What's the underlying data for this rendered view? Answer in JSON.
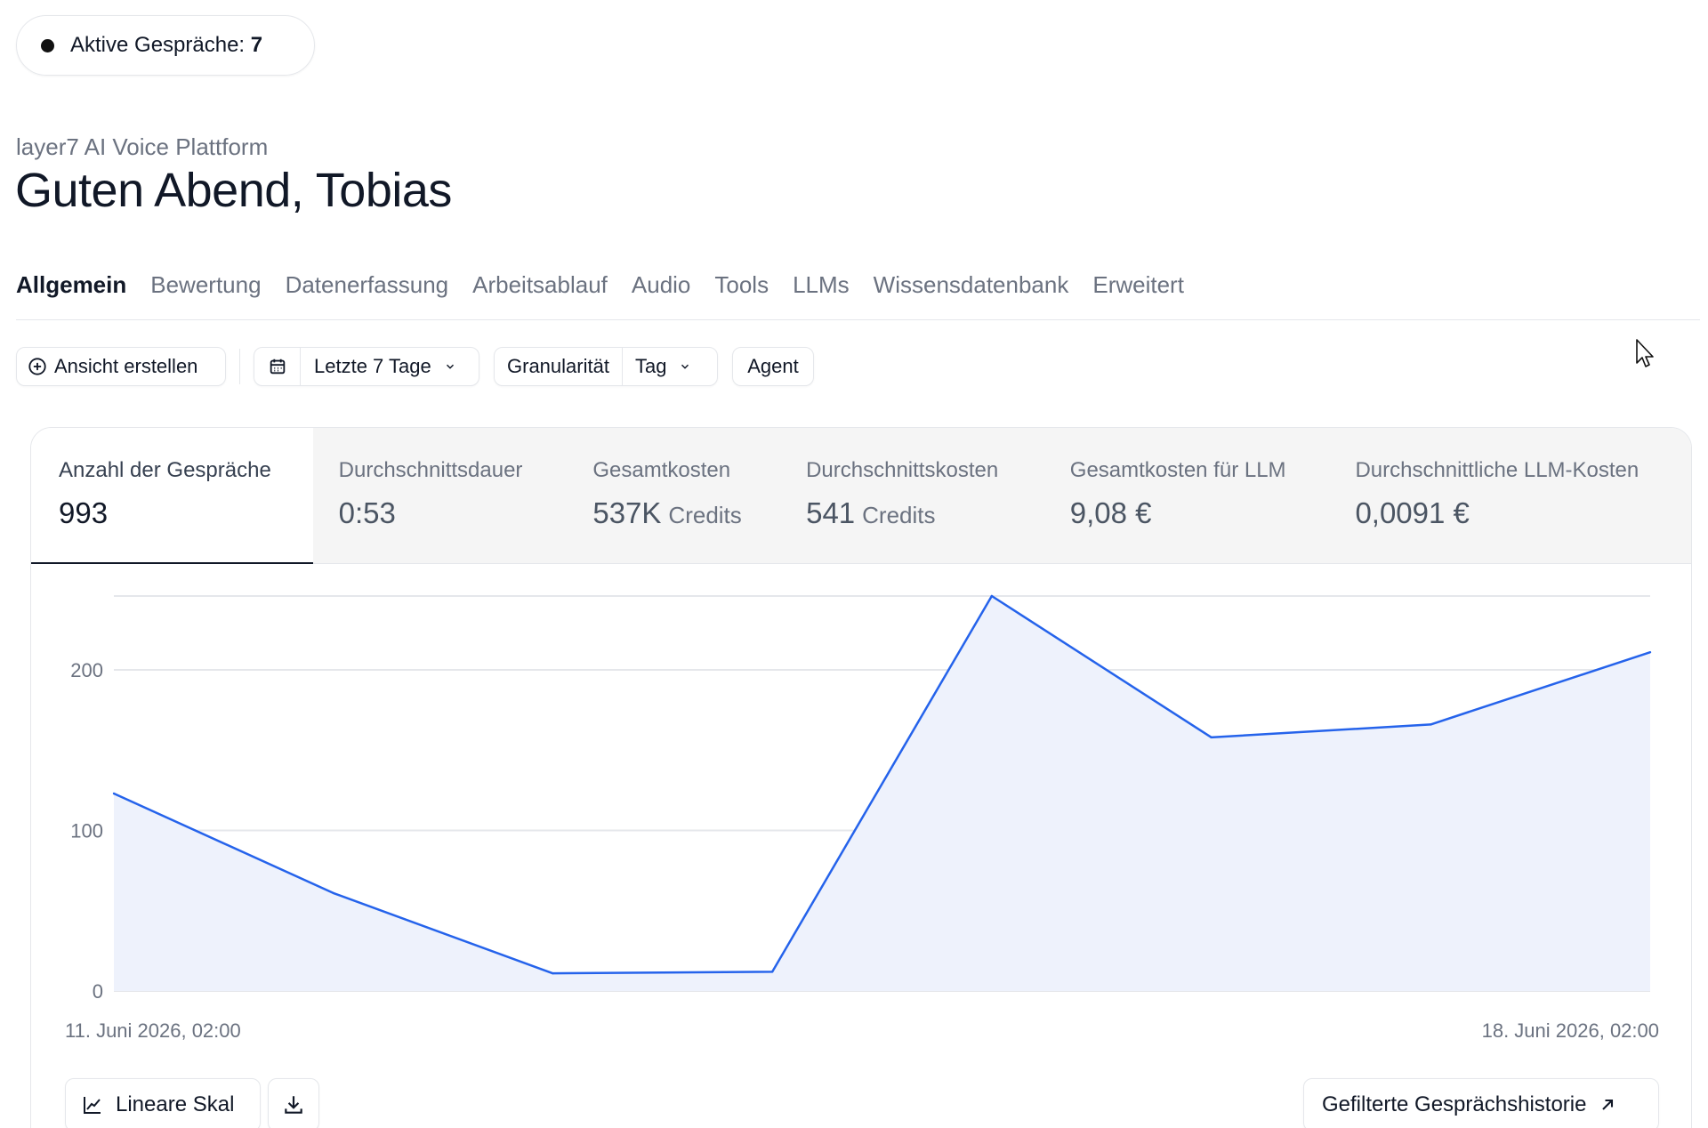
{
  "status": {
    "active_label": "Aktive Gespräche:",
    "active_count": "7"
  },
  "header": {
    "subtitle": "layer7 AI Voice Plattform",
    "greeting": "Guten Abend, Tobias"
  },
  "tabs": [
    {
      "label": "Allgemein",
      "active": true
    },
    {
      "label": "Bewertung"
    },
    {
      "label": "Datenerfassung"
    },
    {
      "label": "Arbeitsablauf"
    },
    {
      "label": "Audio"
    },
    {
      "label": "Tools"
    },
    {
      "label": "LLMs"
    },
    {
      "label": "Wissensdatenbank"
    },
    {
      "label": "Erweitert"
    }
  ],
  "toolbar": {
    "create_view": "Ansicht erstellen",
    "date_range": "Letzte 7 Tage",
    "granularity_label": "Granularität",
    "granularity_value": "Tag",
    "agent": "Agent"
  },
  "metrics": [
    {
      "label": "Anzahl der Gespräche",
      "value": "993",
      "unit": "",
      "active": true
    },
    {
      "label": "Durchschnittsdauer",
      "value": "0:53",
      "unit": ""
    },
    {
      "label": "Gesamtkosten",
      "value": "537K",
      "unit": "Credits"
    },
    {
      "label": "Durchschnittskosten",
      "value": "541",
      "unit": "Credits"
    },
    {
      "label": "Gesamtkosten für LLM",
      "value": "9,08 €",
      "unit": ""
    },
    {
      "label": "Durchschnittliche LLM-Kosten",
      "value": "0,0091 €",
      "unit": ""
    }
  ],
  "chart_data": {
    "type": "area",
    "x_start_label": "11. Juni 2026, 02:00",
    "x_end_label": "18. Juni 2026, 02:00",
    "x": [
      "11. Juni 2026, 02:00",
      "12. Juni 2026, 02:00",
      "13. Juni 2026, 02:00",
      "14. Juni 2026, 02:00",
      "15. Juni 2026, 02:00",
      "16. Juni 2026, 02:00",
      "17. Juni 2026, 02:00",
      "18. Juni 2026, 02:00"
    ],
    "series": [
      {
        "values": [
          123,
          61,
          11,
          12,
          246,
          158,
          166,
          211
        ]
      }
    ],
    "yticks": [
      0,
      100,
      200
    ],
    "ylim": [
      0,
      246
    ],
    "grid": true,
    "color": "#2563eb",
    "fill": "#eef2fc"
  },
  "footer": {
    "scale_label": "Lineare Skal",
    "history_label": "Gefilterte Gesprächshistorie"
  },
  "icons": {
    "status": "status-dot-icon",
    "create": "plus-circle-icon",
    "calendar": "calendar-icon",
    "chevron": "chevron-down-icon",
    "scale": "line-chart-icon",
    "download": "download-icon",
    "external": "arrow-up-right-icon"
  }
}
